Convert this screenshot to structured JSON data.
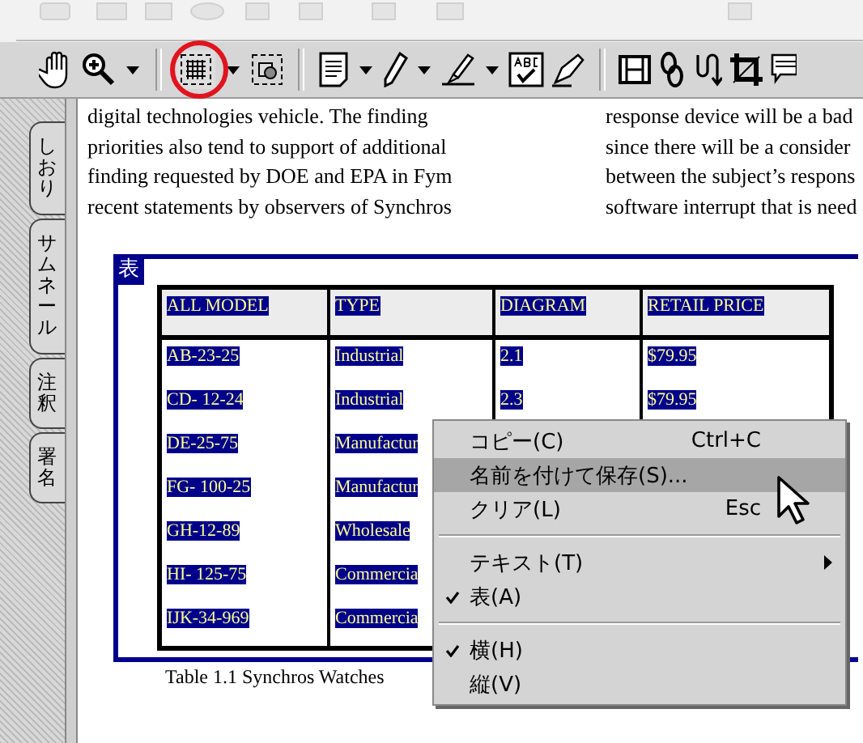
{
  "sidebar": {
    "tabs": [
      {
        "label": "しおり"
      },
      {
        "label": "サムネール"
      },
      {
        "label": "注釈"
      },
      {
        "label": "署名"
      }
    ]
  },
  "document": {
    "text_columns": [
      [
        "digital technologies vehicle. The finding",
        "priorities also tend to support of additional",
        "finding requested by DOE and EPA in Fym",
        "recent statements by observers of Synchros"
      ],
      [
        "response device will be a bad",
        "since there will be a consider",
        "between the subject’s respons",
        "software interrupt that is need"
      ]
    ],
    "table": {
      "tag": "表",
      "columns": [
        "ALL MODEL",
        "TYPE",
        "DIAGRAM",
        "RETAIL PRICE"
      ],
      "rows": [
        [
          "AB-23-25",
          "Industrial",
          "2.1",
          "$79.95"
        ],
        [
          "CD- 12-24",
          "Industrial",
          "2.3",
          "$79.95"
        ],
        [
          "DE-25-75",
          "Manufactur"
        ],
        [
          "FG- 100-25",
          "Manufactur"
        ],
        [
          "GH-12-89",
          "Wholesale"
        ],
        [
          "HI- 125-75",
          "Commercia"
        ],
        [
          "IJK-34-969",
          "Commercia"
        ]
      ]
    },
    "caption": "Table 1.1 Synchros Watches"
  },
  "context_menu": {
    "items": [
      {
        "kind": "item",
        "label": "コピー(C)",
        "shortcut": "Ctrl+C",
        "checked": false,
        "submenu": false,
        "selected": false
      },
      {
        "kind": "item",
        "label": "名前を付けて保存(S)...",
        "checked": false,
        "submenu": false,
        "selected": true
      },
      {
        "kind": "item",
        "label": "クリア(L)",
        "shortcut": "Esc",
        "checked": false,
        "submenu": false,
        "selected": false
      },
      {
        "kind": "separator"
      },
      {
        "kind": "item",
        "label": "テキスト(T)",
        "checked": false,
        "submenu": true,
        "selected": false
      },
      {
        "kind": "item",
        "label": "表(A)",
        "checked": true,
        "submenu": false,
        "selected": false
      },
      {
        "kind": "separator"
      },
      {
        "kind": "item",
        "label": "横(H)",
        "checked": true,
        "submenu": false,
        "selected": false
      },
      {
        "kind": "item",
        "label": "縦(V)",
        "checked": false,
        "submenu": false,
        "selected": false
      }
    ]
  }
}
